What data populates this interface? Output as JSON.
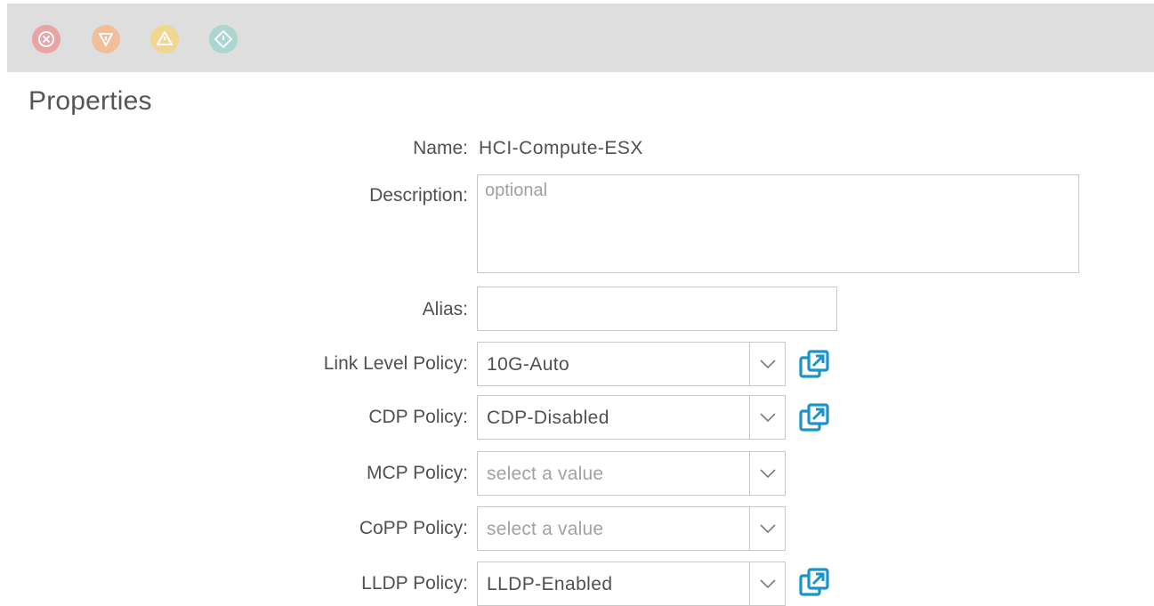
{
  "fault_icons": [
    {
      "name": "critical-fault-icon",
      "color": "#e8a3a3"
    },
    {
      "name": "major-fault-icon",
      "color": "#f0bf9a"
    },
    {
      "name": "minor-fault-icon",
      "color": "#f2d58e"
    },
    {
      "name": "warning-fault-icon",
      "color": "#a9d6d0"
    }
  ],
  "section_title": "Properties",
  "form": {
    "name_label": "Name:",
    "name_value": "HCI-Compute-ESX",
    "description_label": "Description:",
    "description_placeholder": "optional",
    "alias_label": "Alias:",
    "alias_value": "",
    "link_level_label": "Link Level Policy:",
    "link_level_value": "10G-Auto",
    "cdp_label": "CDP Policy:",
    "cdp_value": "CDP-Disabled",
    "mcp_label": "MCP Policy:",
    "mcp_placeholder": "select a value",
    "copp_label": "CoPP Policy:",
    "copp_placeholder": "select a value",
    "lldp_label": "LLDP Policy:",
    "lldp_value": "LLDP-Enabled"
  },
  "colors": {
    "popout_blue": "#1a93c9",
    "text": "#505050",
    "placeholder": "#a2a2a2"
  }
}
